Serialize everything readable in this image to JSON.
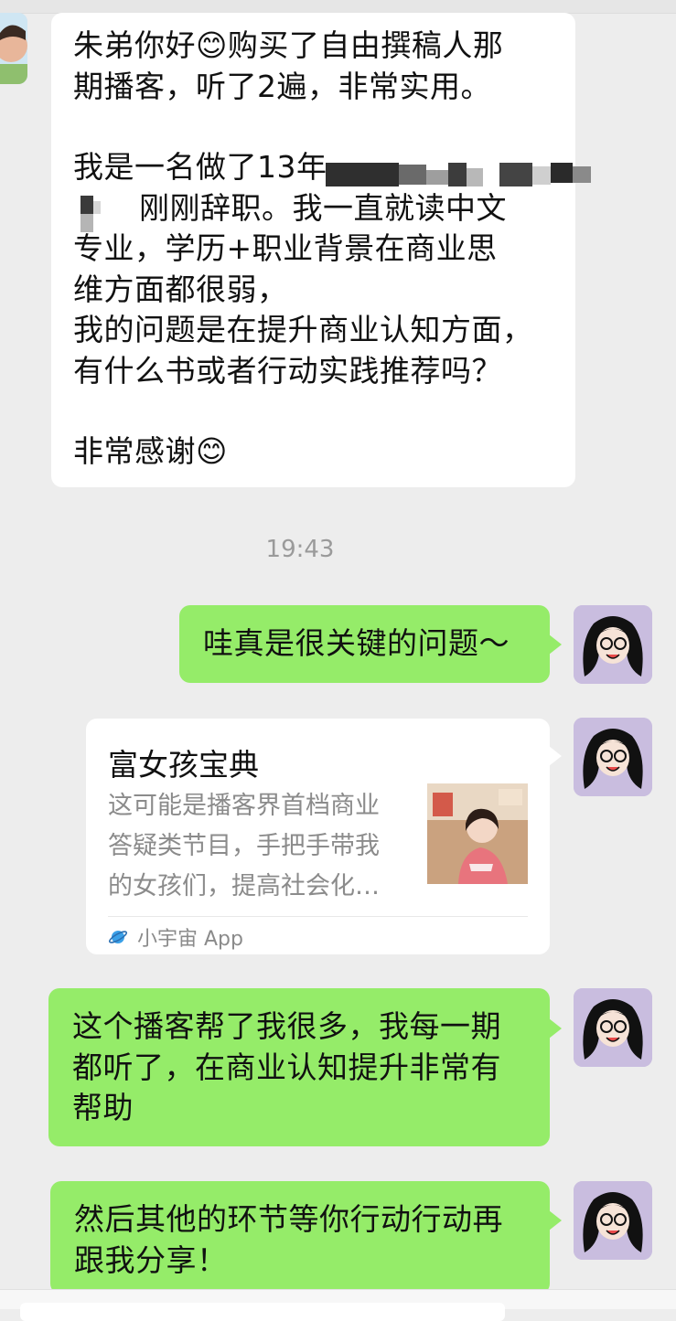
{
  "messages": {
    "first": {
      "l1": "朱弟你好😊购买了自由撰稿人那",
      "l2": "期播客，听了2遍，非常实用。",
      "l3": "我是一名做了13年",
      "l4": "刚刚辞职。我一直就读中文",
      "l5": "专业，学历+职业背景在商业思",
      "l6": "维方面都很弱，",
      "l7": "我的问题是在提升商业认知方面，",
      "l8": "有什么书或者行动实践推荐吗？",
      "l9": "非常感谢😊"
    },
    "timestamp": "19:43",
    "reply1": "哇真是很关键的问题～",
    "card": {
      "title": "富女孩宝典",
      "desc1": "这可能是播客界首档商业",
      "desc2": "答疑类节目，手把手带我",
      "desc3": "的女孩们，提高社会化…",
      "source": "小宇宙 App"
    },
    "reply2": {
      "l1": "这个播客帮了我很多，我每一期",
      "l2": "都听了，在商业认知提升非常有",
      "l3": "帮助"
    },
    "reply3": {
      "l1": "然后其他的环节等你行动行动再",
      "l2": "跟我分享！"
    }
  },
  "colors": {
    "background": "#ededed",
    "sent_bubble": "#95ec69",
    "received_bubble": "#ffffff",
    "timestamp": "#9a9a9a"
  },
  "icons": {
    "card_source": "xiaoyuzhou-planet-icon"
  }
}
